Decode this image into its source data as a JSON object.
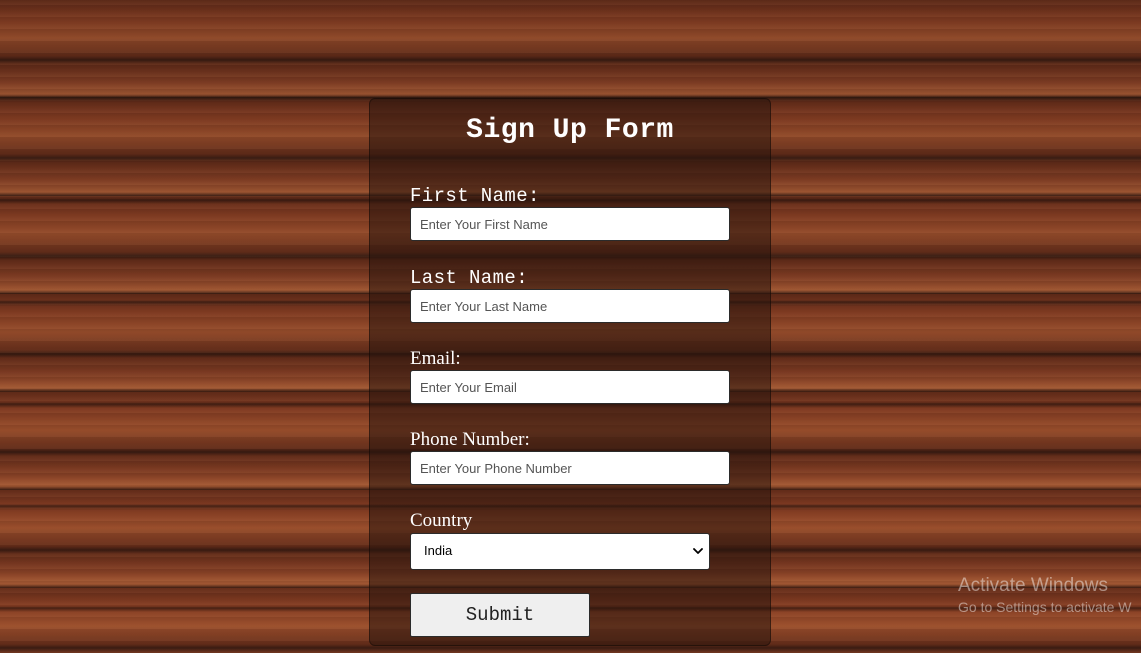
{
  "form": {
    "title": "Sign Up Form",
    "first_name": {
      "label": "First Name:",
      "placeholder": "Enter Your First Name",
      "value": ""
    },
    "last_name": {
      "label": "Last Name:",
      "placeholder": "Enter Your Last Name",
      "value": ""
    },
    "email": {
      "label": "Email:",
      "placeholder": "Enter Your Email",
      "value": ""
    },
    "phone": {
      "label": "Phone Number:",
      "placeholder": "Enter Your Phone Number",
      "value": ""
    },
    "country": {
      "label": "Country",
      "selected": "India"
    },
    "submit_label": "Submit"
  },
  "watermark": {
    "title": "Activate Windows",
    "subtitle": "Go to Settings to activate W"
  },
  "icons": {
    "select_arrow": "chevron-down-icon"
  },
  "colors": {
    "panel": "#281408",
    "text": "#ffffff",
    "button_bg": "#efefef"
  }
}
